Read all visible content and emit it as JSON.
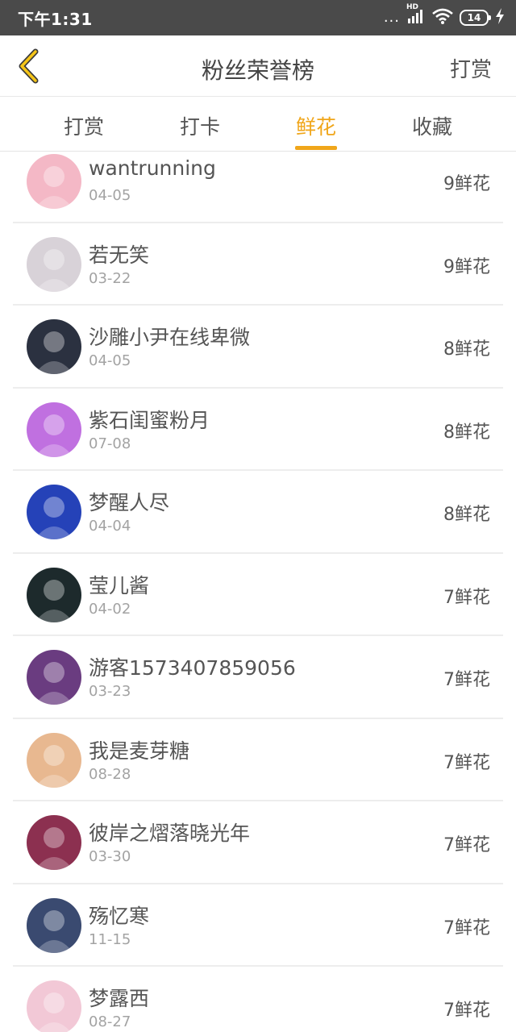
{
  "status_bar": {
    "time": "下午1:31",
    "signal_dots": "...",
    "network": "HD",
    "battery": "14"
  },
  "header": {
    "title": "粉丝荣誉榜",
    "action_label": "打赏"
  },
  "tabs": [
    {
      "label": "打赏",
      "active": false
    },
    {
      "label": "打卡",
      "active": false
    },
    {
      "label": "鲜花",
      "active": true
    },
    {
      "label": "收藏",
      "active": false
    }
  ],
  "list": [
    {
      "name": "wantrunning",
      "date": "04-05",
      "count": "9鲜花",
      "avatar_color": "#f4b8c6"
    },
    {
      "name": "若无笑",
      "date": "03-22",
      "count": "9鲜花",
      "avatar_color": "#d8d2d8"
    },
    {
      "name": "沙雕小尹在线卑微",
      "date": "04-05",
      "count": "8鲜花",
      "avatar_color": "#2b3140"
    },
    {
      "name": "紫石闺蜜粉月",
      "date": "07-08",
      "count": "8鲜花",
      "avatar_color": "#c070e0"
    },
    {
      "name": "梦醒人尽",
      "date": "04-04",
      "count": "8鲜花",
      "avatar_color": "#2542b8"
    },
    {
      "name": "莹儿酱",
      "date": "04-02",
      "count": "7鲜花",
      "avatar_color": "#1d2a2c"
    },
    {
      "name": "游客1573407859056",
      "date": "03-23",
      "count": "7鲜花",
      "avatar_color": "#6a3c80"
    },
    {
      "name": "我是麦芽糖",
      "date": "08-28",
      "count": "7鲜花",
      "avatar_color": "#e8b890"
    },
    {
      "name": "彼岸之熠落晓光年",
      "date": "03-30",
      "count": "7鲜花",
      "avatar_color": "#8c3050"
    },
    {
      "name": "殇忆寒",
      "date": "11-15",
      "count": "7鲜花",
      "avatar_color": "#3a4a70"
    },
    {
      "name": "梦露西",
      "date": "08-27",
      "count": "7鲜花",
      "avatar_color": "#f2c8d6"
    }
  ]
}
